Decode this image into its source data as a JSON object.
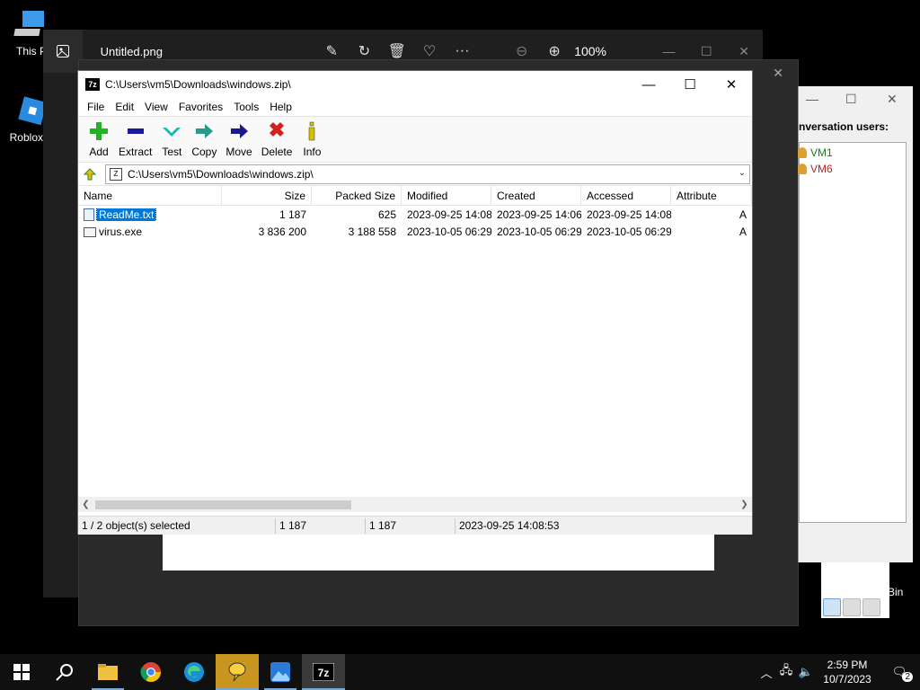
{
  "desktop": {
    "icons": [
      {
        "label": "This P"
      },
      {
        "label": "Roblox S"
      }
    ]
  },
  "photos": {
    "title": "Untitled.png",
    "zoom": "100%"
  },
  "chat": {
    "label": "nversation users:",
    "users": [
      {
        "name": "VM1",
        "color": "#1a7a1a"
      },
      {
        "name": "VM6",
        "color": "#b22222"
      }
    ]
  },
  "recycle_bin_label": "Bin",
  "zip": {
    "title": "C:\\Users\\vm5\\Downloads\\windows.zip\\",
    "menu": [
      "File",
      "Edit",
      "View",
      "Favorites",
      "Tools",
      "Help"
    ],
    "toolbar": [
      {
        "label": "Add",
        "icon": "add-icon"
      },
      {
        "label": "Extract",
        "icon": "extract-icon"
      },
      {
        "label": "Test",
        "icon": "test-icon"
      },
      {
        "label": "Copy",
        "icon": "copy-icon"
      },
      {
        "label": "Move",
        "icon": "move-icon"
      },
      {
        "label": "Delete",
        "icon": "delete-icon"
      },
      {
        "label": "Info",
        "icon": "info-icon"
      }
    ],
    "address": "C:\\Users\\vm5\\Downloads\\windows.zip\\",
    "columns": [
      "Name",
      "Size",
      "Packed Size",
      "Modified",
      "Created",
      "Accessed",
      "Attribute"
    ],
    "files": [
      {
        "name": "ReadMe.txt",
        "size": "1 187",
        "packed": "625",
        "modified": "2023-09-25 14:08",
        "created": "2023-09-25 14:06",
        "accessed": "2023-09-25 14:08",
        "attr": "A",
        "selected": true
      },
      {
        "name": "virus.exe",
        "size": "3 836 200",
        "packed": "3 188 558",
        "modified": "2023-10-05 06:29",
        "created": "2023-10-05 06:29",
        "accessed": "2023-10-05 06:29",
        "attr": "A",
        "selected": false
      }
    ],
    "status": {
      "selection": "1 / 2 object(s) selected",
      "size": "1 187",
      "packed": "1 187",
      "modified": "2023-09-25 14:08:53"
    }
  },
  "taskbar": {
    "time": "2:59 PM",
    "date": "10/7/2023",
    "notifications": "2"
  }
}
